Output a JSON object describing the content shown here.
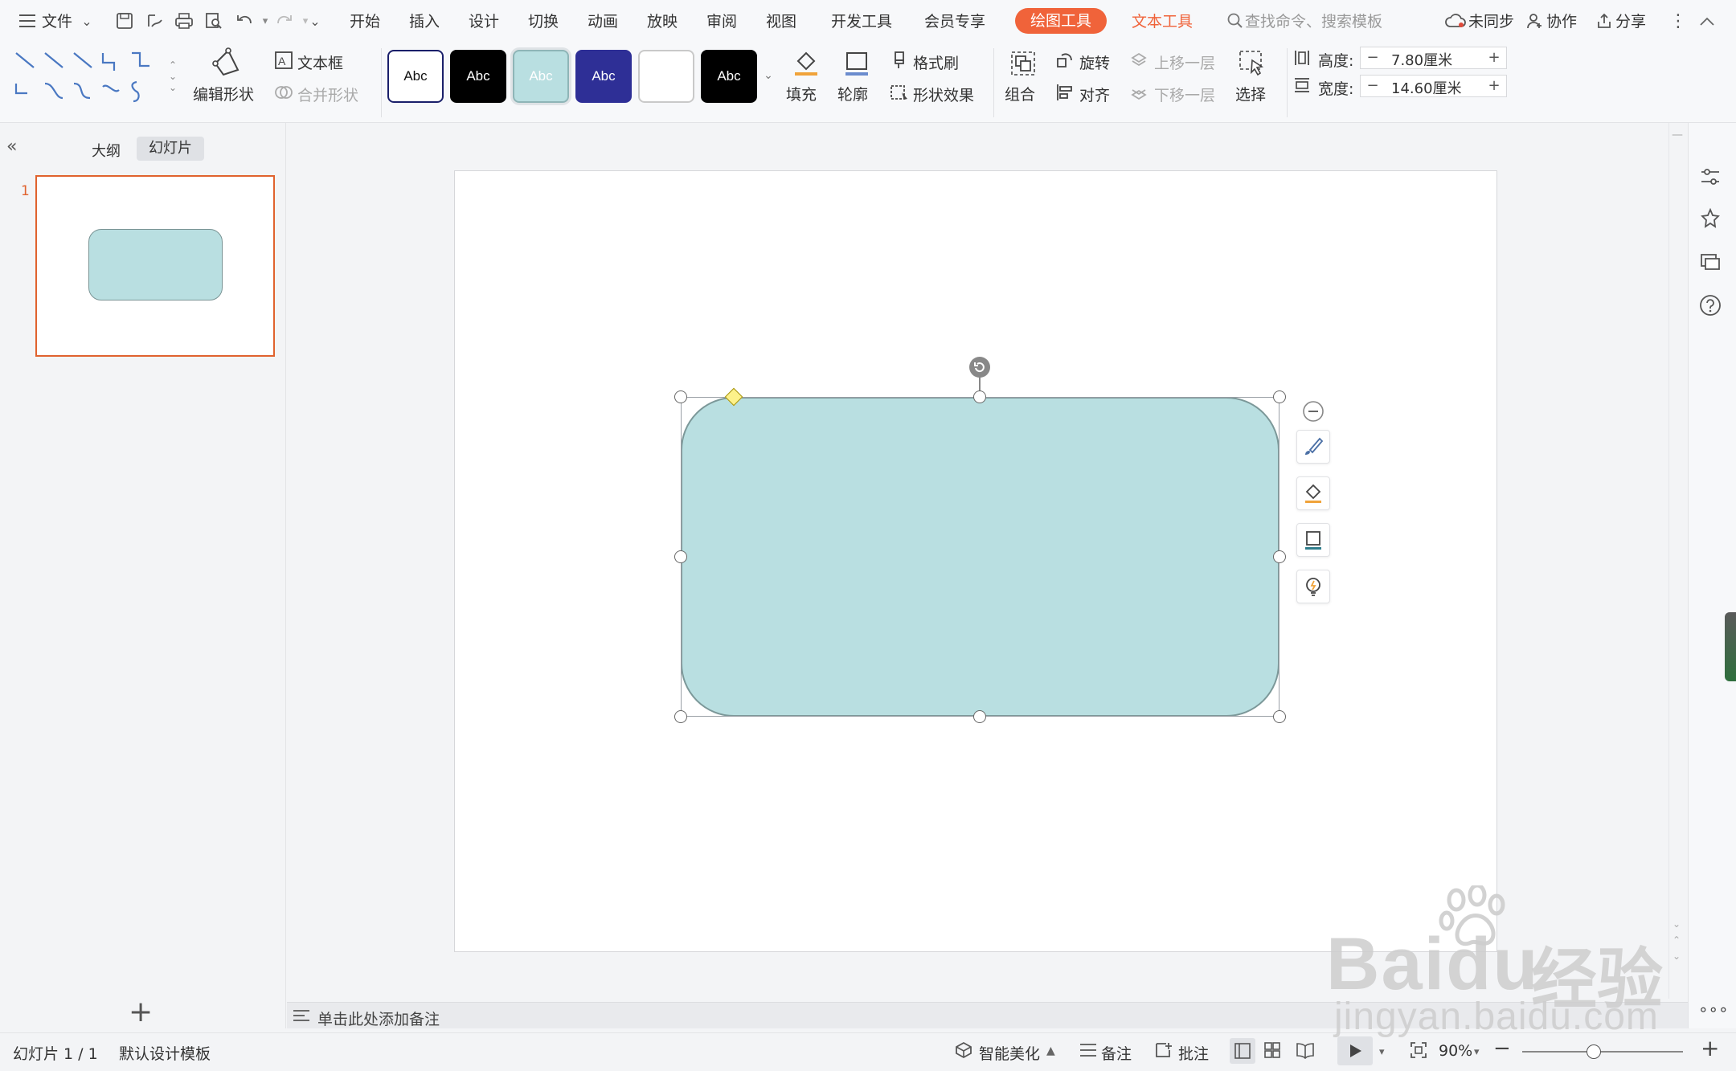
{
  "menubar": {
    "file": "文件",
    "tabs": [
      "开始",
      "插入",
      "设计",
      "切换",
      "动画",
      "放映",
      "审阅",
      "视图",
      "开发工具",
      "会员专享"
    ],
    "drawing_tools": "绘图工具",
    "text_tools": "文本工具",
    "search_placeholder": "查找命令、搜索模板",
    "sync": "未同步",
    "collab": "协作",
    "share": "分享"
  },
  "ribbon": {
    "edit_shape": "编辑形状",
    "text_box": "文本框",
    "merge_shape": "合并形状",
    "style_samples": [
      {
        "text": "Abc",
        "bg": "#ffffff",
        "fg": "#111111",
        "border": "#1a1f6a"
      },
      {
        "text": "Abc",
        "bg": "#000000",
        "fg": "#ffffff",
        "border": "#000000"
      },
      {
        "text": "Abc",
        "bg": "#b9dfe1",
        "fg": "#ffffff",
        "border": "#8fb5b7"
      },
      {
        "text": "Abc",
        "bg": "#2e2f96",
        "fg": "#ffffff",
        "border": "#2e2f96"
      },
      {
        "text": "",
        "bg": "#ffffff",
        "fg": "#111111",
        "border": "#c9c9c9"
      },
      {
        "text": "Abc",
        "bg": "#000000",
        "fg": "#ffffff",
        "border": "#000000"
      }
    ],
    "fill": "填充",
    "outline": "轮廓",
    "format_painter": "格式刷",
    "shape_effects": "形状效果",
    "group": "组合",
    "rotate": "旋转",
    "align": "对齐",
    "bring_forward": "上移一层",
    "send_backward": "下移一层",
    "select": "选择",
    "height_label": "高度:",
    "height_value": "7.80厘米",
    "width_label": "宽度:",
    "width_value": "14.60厘米"
  },
  "leftpanel": {
    "outline_tab": "大纲",
    "slides_tab": "幻灯片",
    "slide_number": "1"
  },
  "notes": {
    "placeholder": "单击此处添加备注"
  },
  "status": {
    "slide_info": "幻灯片 1 / 1",
    "template": "默认设计模板",
    "smart_beautify": "智能美化",
    "notes": "备注",
    "comments": "批注",
    "zoom": "90%"
  },
  "watermark": {
    "brand": "Baidu",
    "brand_cn": "经验",
    "url": "jingyan.baidu.com"
  },
  "colors": {
    "accent": "#f0633a",
    "shape_fill": "#b9dfe1",
    "shape_border": "#7c9899"
  }
}
